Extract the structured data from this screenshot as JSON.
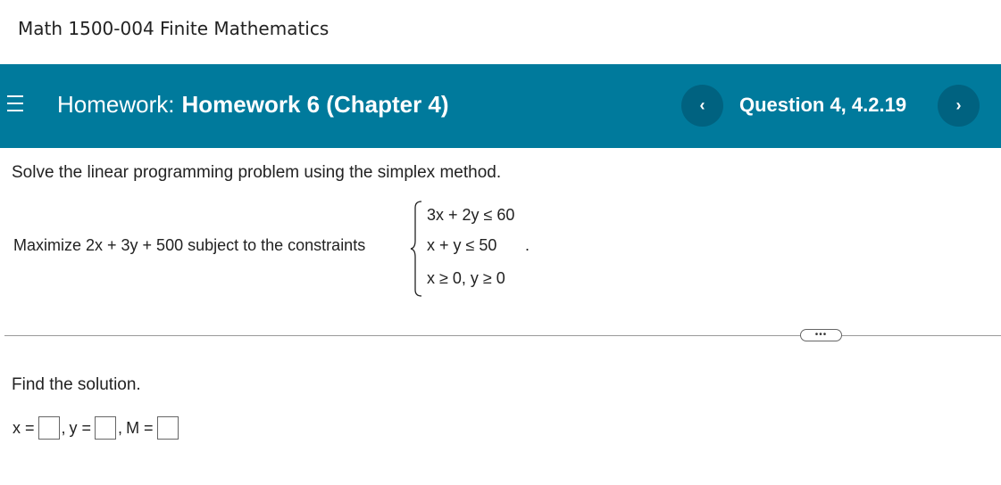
{
  "course": {
    "title": "Math 1500-004 Finite Mathematics"
  },
  "header": {
    "menu_icon": "hamburger-menu-icon",
    "homework_label": "Homework:",
    "homework_name": "Homework 6 (Chapter 4)",
    "question_label": "Question 4, 4.2.19",
    "prev_icon": "chevron-left-icon",
    "next_icon": "chevron-right-icon",
    "prev_glyph": "‹",
    "next_glyph": "›",
    "bar_color": "#007a9c"
  },
  "problem": {
    "instructions": "Solve the linear programming problem using the simplex method.",
    "objective": "Maximize 2x + 3y + 500 subject to the constraints",
    "constraints": [
      "3x + 2y ≤ 60",
      "x + y ≤ 50",
      "x ≥ 0, y ≥ 0"
    ],
    "terminator": "."
  },
  "more_button": {
    "label": "•••"
  },
  "answer": {
    "prompt": "Find the solution.",
    "x_label": "x =",
    "y_label": "y =",
    "m_label": "M =",
    "separator": ",",
    "x_value": "",
    "y_value": "",
    "m_value": ""
  }
}
